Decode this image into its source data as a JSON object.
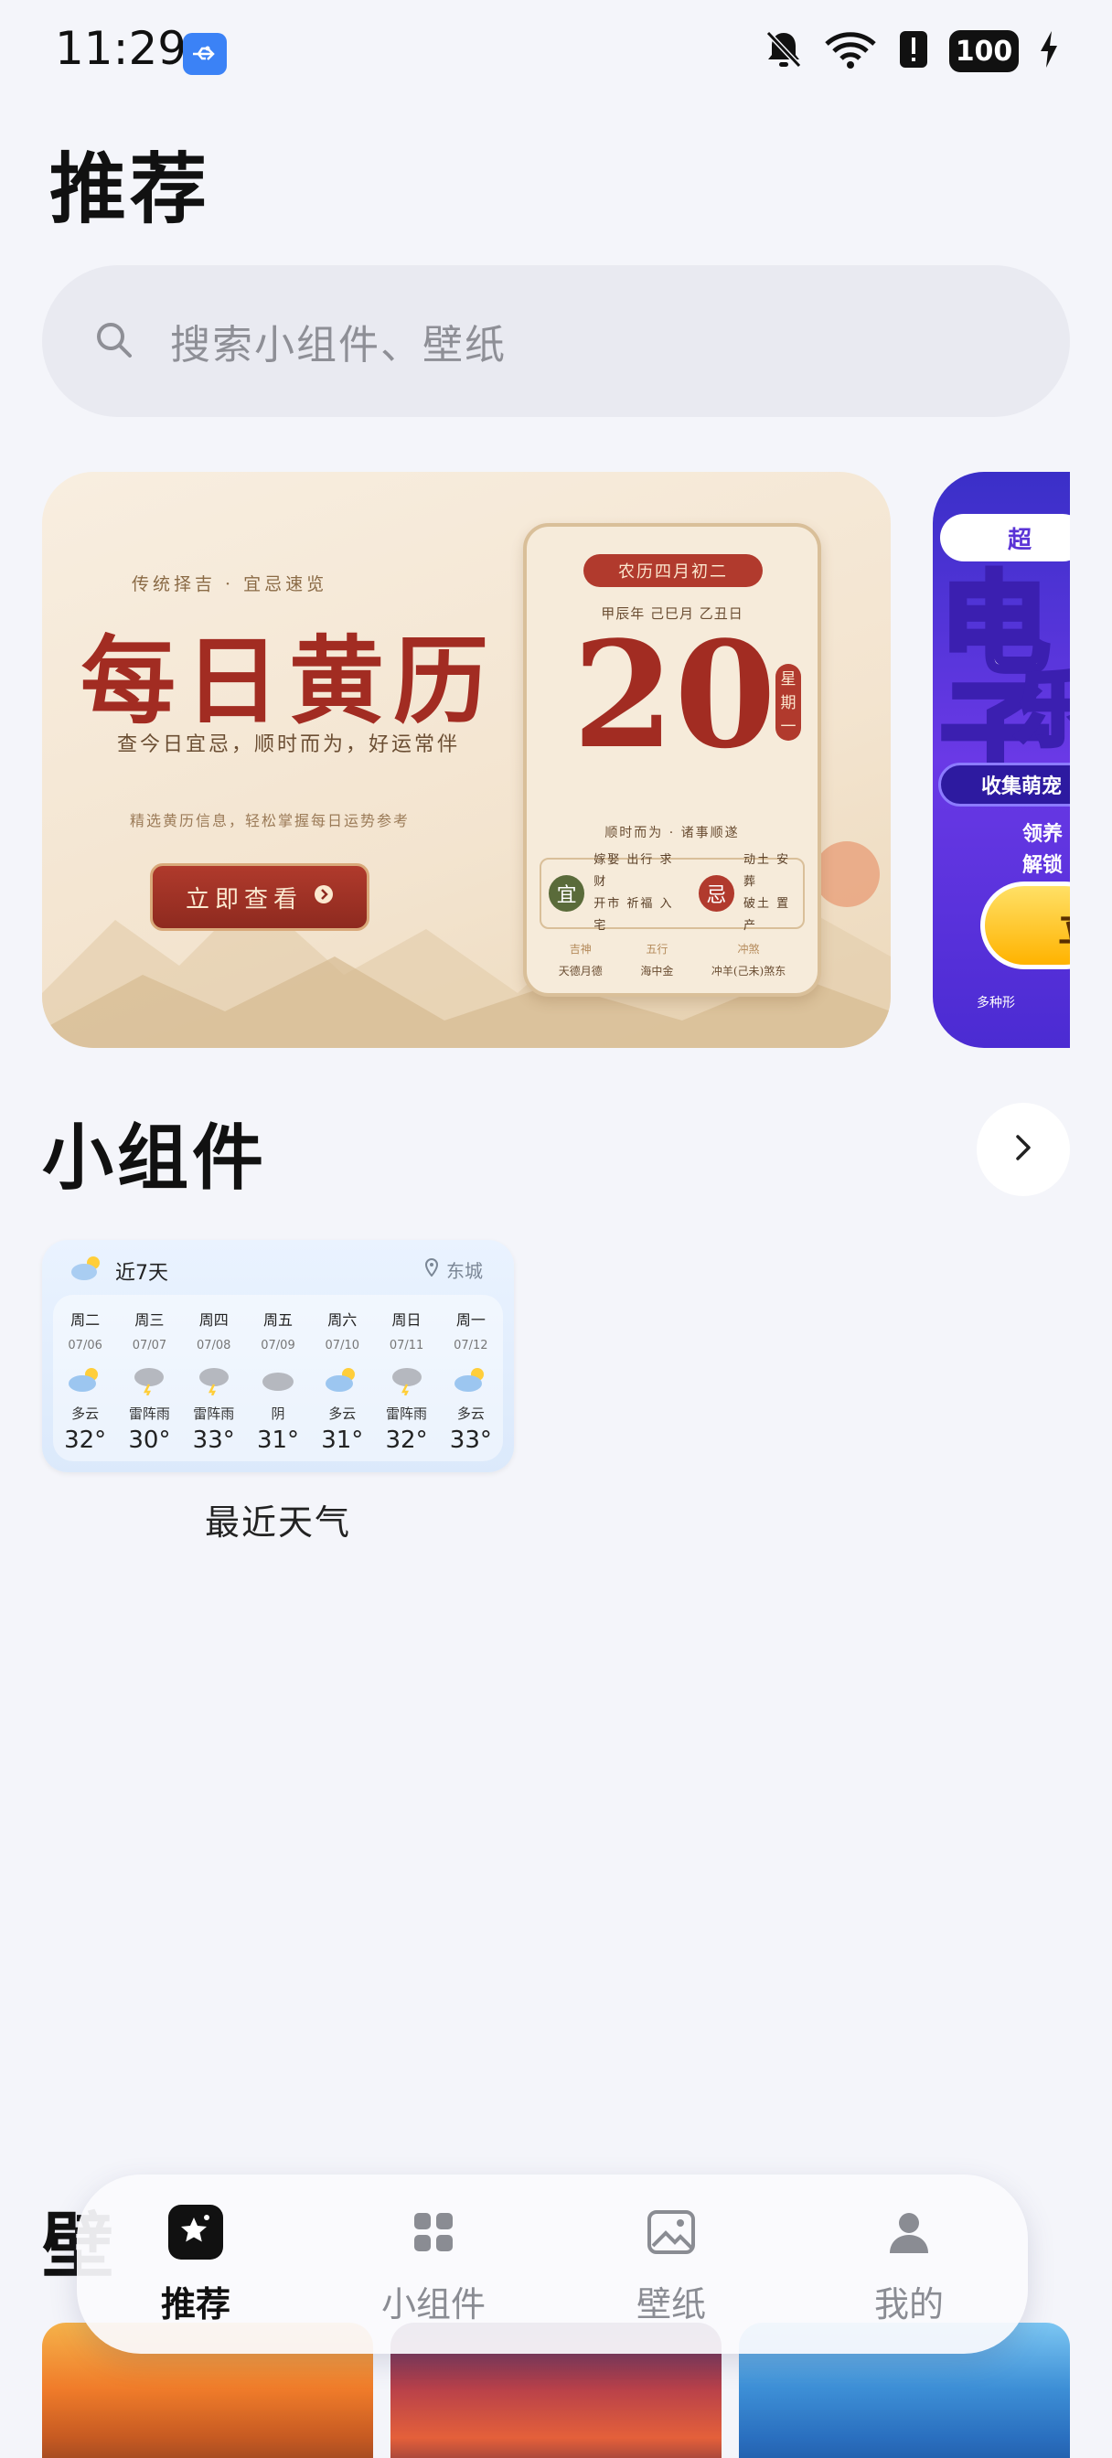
{
  "status_bar": {
    "time": "11:29",
    "battery": "100"
  },
  "page_title": "推荐",
  "search": {
    "placeholder": "搜索小组件、壁纸"
  },
  "banner": {
    "eyebrow": "传统择吉 · 宜忌速览",
    "title": "每日黄历",
    "subtitle": "查今日宜忌，顺时而为，好运常伴",
    "desc": "精选黄历信息，轻松掌握每日运势参考",
    "button": "立即查看",
    "calendar": {
      "lunar": "农历四月初二",
      "ganzhi": "甲辰年  己巳月  乙丑日",
      "day": "20",
      "weekday": "星期一",
      "motto": "顺时而为 · 诸事顺遂",
      "yi_seal": "宜",
      "yi_text_1": "嫁娶  出行  求财",
      "yi_text_2": "开市  祈福  入宅",
      "ji_seal": "忌",
      "ji_text_1": "动土  安葬",
      "ji_text_2": "破土  置产",
      "foot": [
        {
          "key": "吉神",
          "val": "天德月德"
        },
        {
          "key": "五行",
          "val": "海中金"
        },
        {
          "key": "冲煞",
          "val": "冲羊(己未)煞东"
        }
      ]
    }
  },
  "banner2": {
    "pill": "超",
    "big": "电子",
    "big2": "乐",
    "tag": "收集萌宠",
    "desc_1": "领养",
    "desc_2": "解锁",
    "button": "立",
    "foot": "多种形"
  },
  "widgets_section": {
    "title": "小组件"
  },
  "weather_widget": {
    "title": "近7天",
    "location": "东城",
    "label": "最近天气",
    "days": [
      {
        "name": "周二",
        "date": "07/06",
        "cond": "多云",
        "temp": "32°",
        "icon": "partly-cloudy"
      },
      {
        "name": "周三",
        "date": "07/07",
        "cond": "雷阵雨",
        "temp": "30°",
        "icon": "thunderstorm"
      },
      {
        "name": "周四",
        "date": "07/08",
        "cond": "雷阵雨",
        "temp": "33°",
        "icon": "thunderstorm"
      },
      {
        "name": "周五",
        "date": "07/09",
        "cond": "阴",
        "temp": "31°",
        "icon": "overcast"
      },
      {
        "name": "周六",
        "date": "07/10",
        "cond": "多云",
        "temp": "31°",
        "icon": "partly-cloudy"
      },
      {
        "name": "周日",
        "date": "07/11",
        "cond": "雷阵雨",
        "temp": "32°",
        "icon": "thunderstorm"
      },
      {
        "name": "周一",
        "date": "07/12",
        "cond": "多云",
        "temp": "33°",
        "icon": "partly-cloudy"
      }
    ]
  },
  "wallpaper_section": {
    "title": "壁"
  },
  "tabbar": {
    "tabs": [
      {
        "label": "推荐",
        "icon": "star-icon",
        "active": true
      },
      {
        "label": "小组件",
        "icon": "grid-icon",
        "active": false
      },
      {
        "label": "壁纸",
        "icon": "image-icon",
        "active": false
      },
      {
        "label": "我的",
        "icon": "person-icon",
        "active": false
      }
    ]
  },
  "colors": {
    "accent": "#a22c22",
    "background": "#f4f5fa"
  }
}
